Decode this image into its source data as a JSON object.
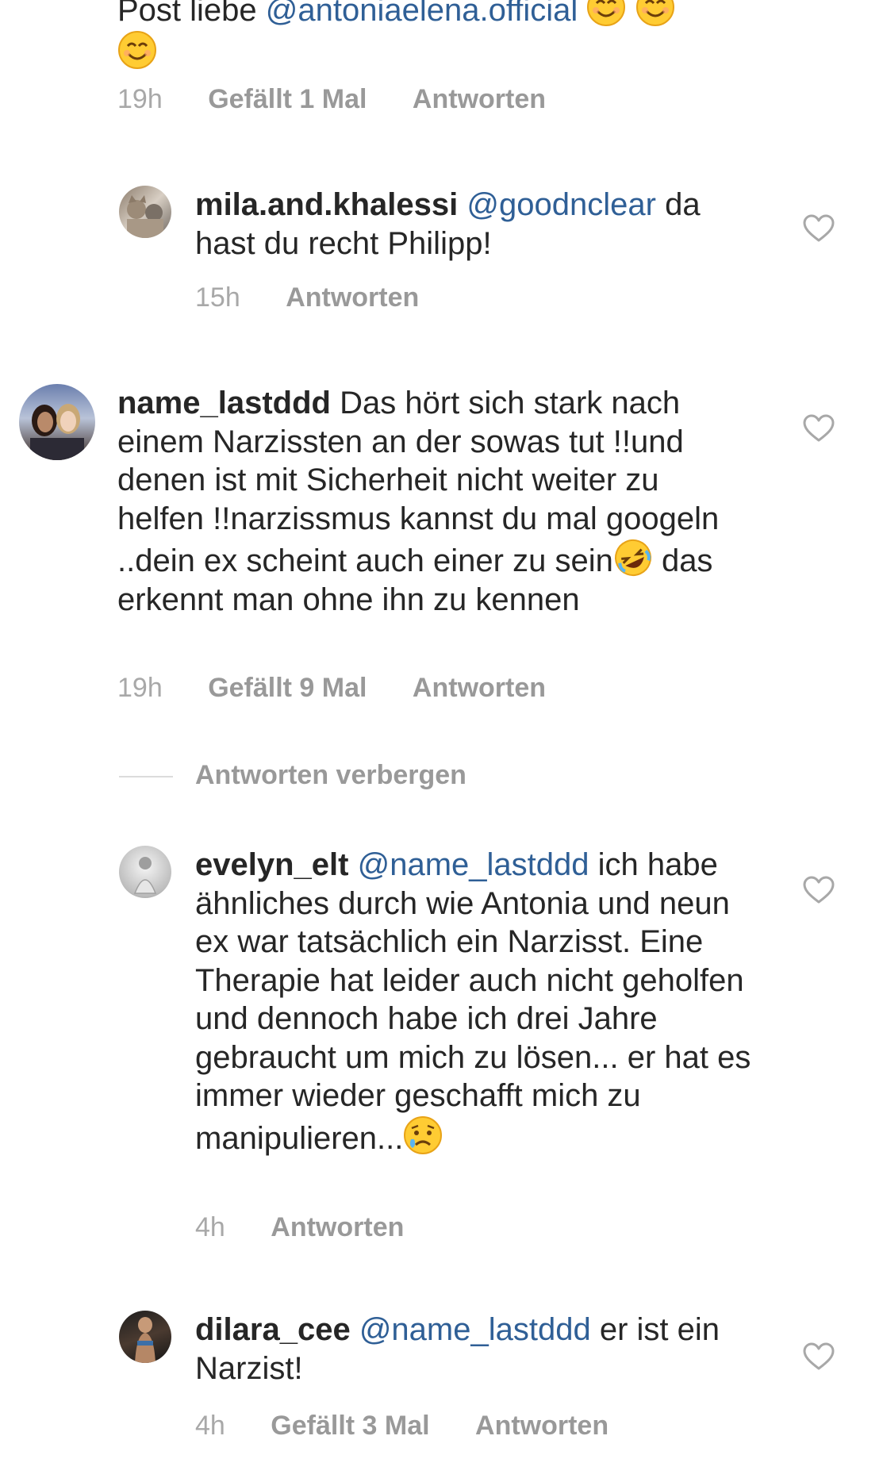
{
  "comments": [
    {
      "id": "top_partial",
      "text_prefix": "Post liebe ",
      "mention": "@antoniaelena.official",
      "emoji": [
        "smiling-face-emoji",
        "smiling-face-emoji",
        "smiling-face-emoji"
      ],
      "time": "19h",
      "likes": "Gefällt 1 Mal",
      "reply": "Antworten"
    },
    {
      "id": "mila",
      "username": "mila.and.khalessi",
      "mention": "@goodnclear",
      "text": " da hast du recht Philipp!",
      "time": "15h",
      "reply": "Antworten"
    },
    {
      "id": "name_lastddd",
      "username": "name_lastddd",
      "text_a": " Das hört sich stark nach einem Narzissten an der sowas tut !!und denen ist mit Sicherheit nicht weiter zu helfen !!narzissmus kannst du mal googeln ..dein ex scheint auch einer zu sein",
      "emoji": "rolling-on-floor-laughing-emoji",
      "text_b": " das erkennt man ohne ihn zu kennen",
      "time": "19h",
      "likes": "Gefällt 9 Mal",
      "reply": "Antworten"
    },
    {
      "id": "evelyn",
      "username": "evelyn_elt",
      "mention": "@name_lastddd",
      "text": " ich habe ähnliches durch wie Antonia und neun ex war tatsächlich ein Narzisst. Eine Therapie hat leider auch nicht geholfen und dennoch habe ich drei Jahre gebraucht um mich zu lösen... er hat es immer wieder geschafft mich zu manipulieren...",
      "emoji": "sad-but-relieved-face-emoji",
      "time": "4h",
      "reply": "Antworten"
    },
    {
      "id": "dilara",
      "username": "dilara_cee",
      "mention": "@name_lastddd",
      "text": " er ist ein Narzist!",
      "time": "4h",
      "likes": "Gefällt 3 Mal",
      "reply": "Antworten"
    }
  ],
  "hide_replies": "Antworten verbergen",
  "colors": {
    "text": "#262626",
    "mention": "#2f5f96",
    "meta": "#999999"
  }
}
